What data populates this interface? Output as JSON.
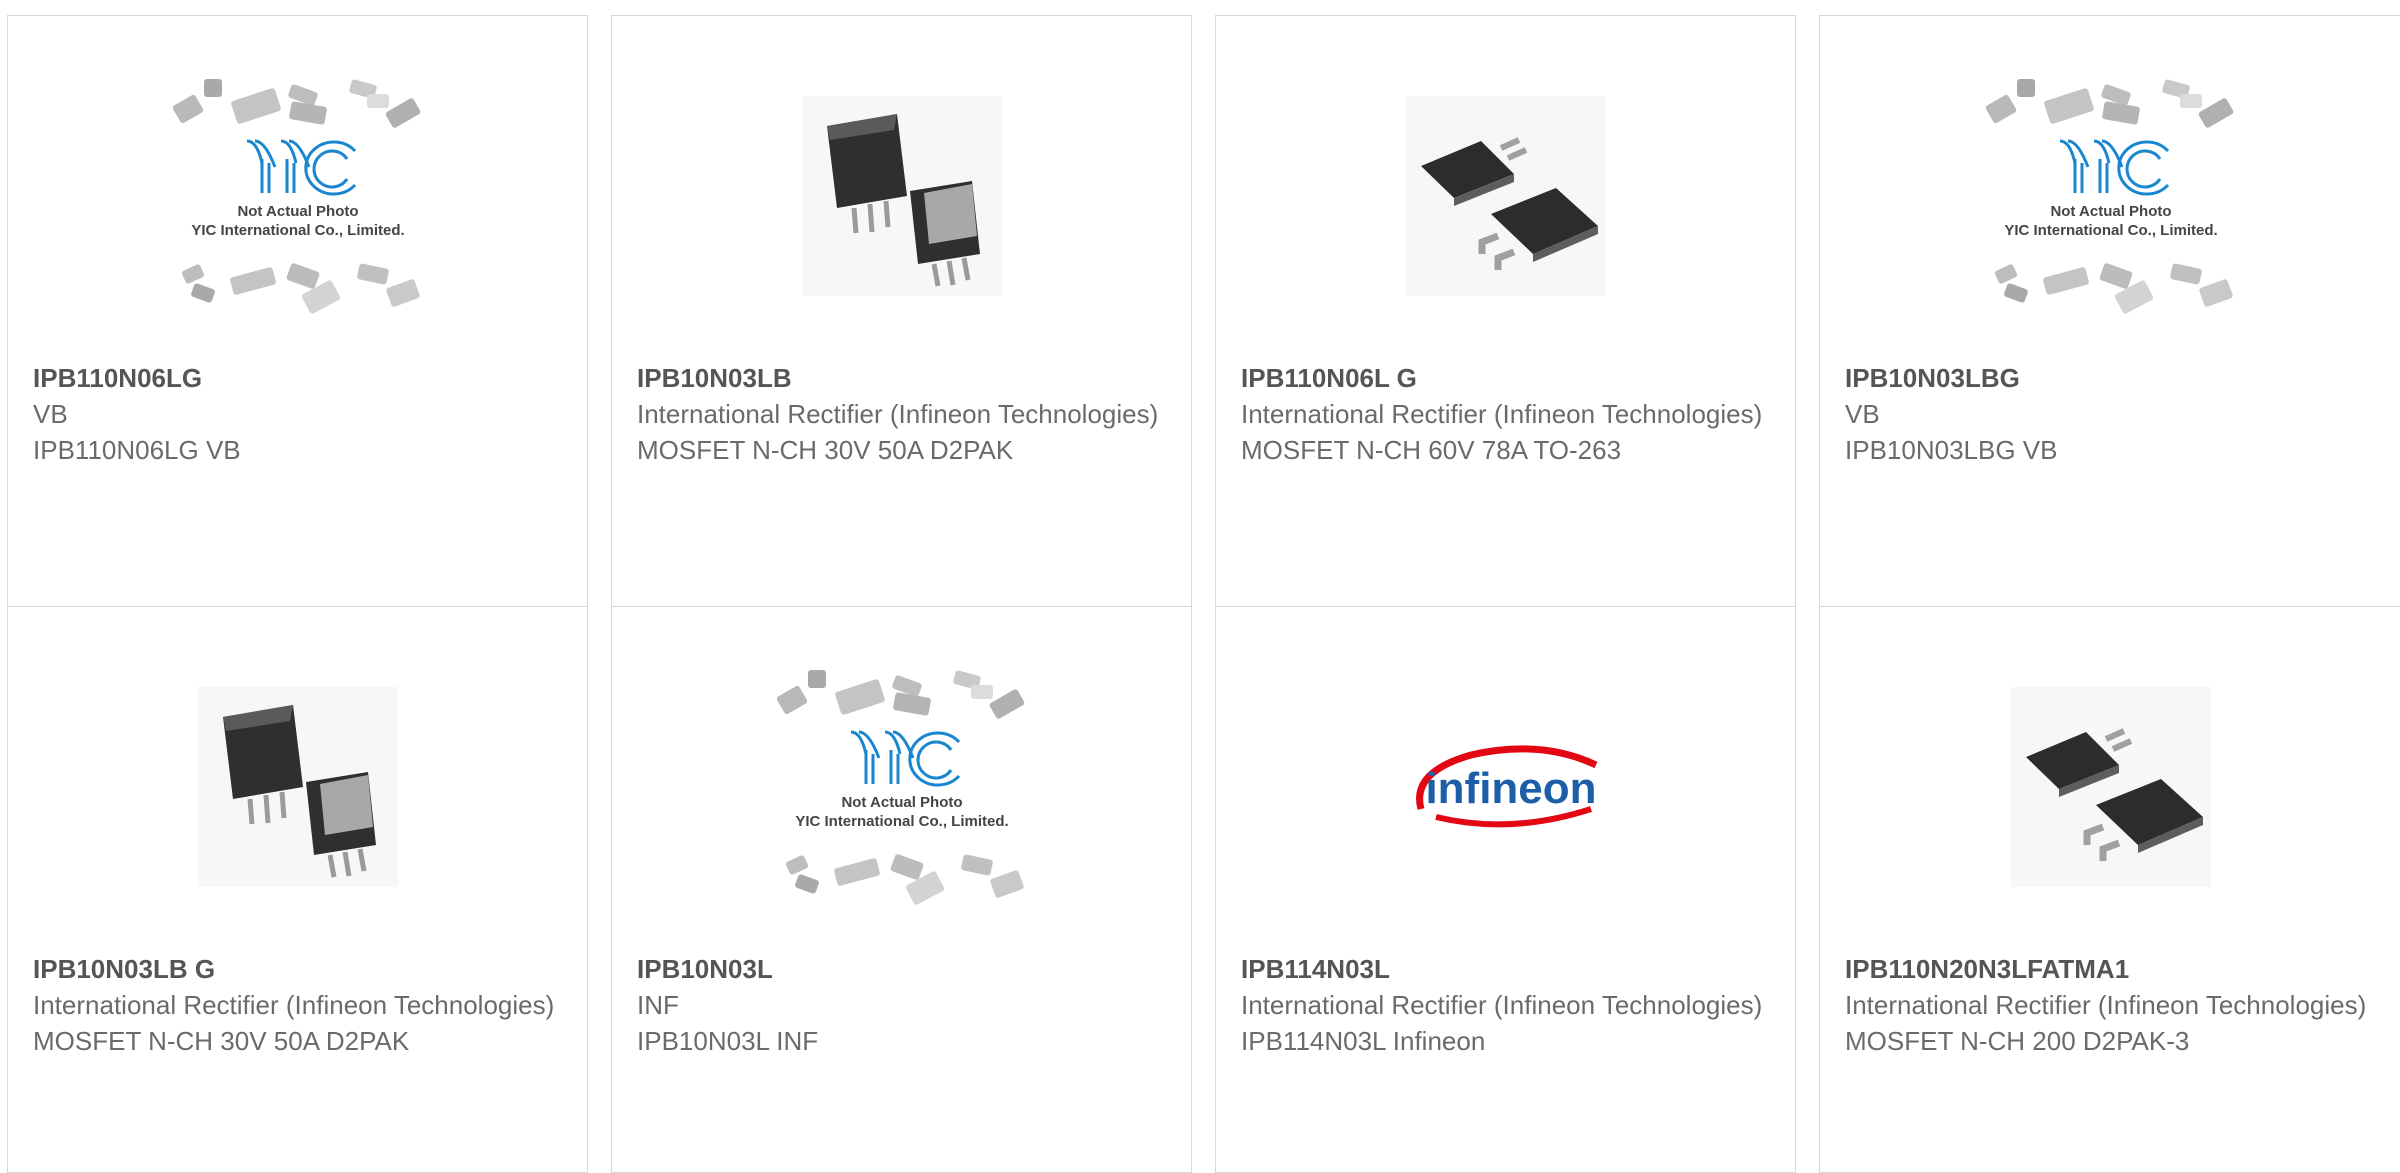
{
  "colors": {
    "accent": "#e8391b",
    "bar": "#3d3d3d",
    "part_number": "#555555",
    "text": "#6a6a6a",
    "yic_blue": "#1a86d0",
    "infineon_red": "#e30613",
    "infineon_blue": "#1c5ea7"
  },
  "placeholder": {
    "line1": "Not Actual Photo",
    "line2": "YIC International Co., Limited.",
    "logo": "YIC"
  },
  "infineon_logo": "infineon",
  "products": [
    {
      "part_number": "IPB110N06LG",
      "manufacturer": "VB",
      "description": "IPB110N06LG VB",
      "image": "placeholder-icon"
    },
    {
      "part_number": "IPB10N03LB",
      "manufacturer": "International Rectifier (Infineon Technologies)",
      "description": "MOSFET N-CH 30V 50A D2PAK",
      "image": "d2pak-angled-icon"
    },
    {
      "part_number": "IPB110N06L G",
      "manufacturer": "International Rectifier (Infineon Technologies)",
      "description": "MOSFET N-CH 60V 78A TO-263",
      "image": "d2pak-flat-icon"
    },
    {
      "part_number": "IPB10N03LBG",
      "manufacturer": "VB",
      "description": "IPB10N03LBG VB",
      "image": "placeholder-icon"
    },
    {
      "part_number": "IPB10N03LB G",
      "manufacturer": "International Rectifier (Infineon Technologies)",
      "description": "MOSFET N-CH 30V 50A D2PAK",
      "image": "d2pak-angled-icon"
    },
    {
      "part_number": "IPB10N03L",
      "manufacturer": "INF",
      "description": "IPB10N03L INF",
      "image": "placeholder-icon"
    },
    {
      "part_number": "IPB114N03L",
      "manufacturer": "International Rectifier (Infineon Technologies)",
      "description": "IPB114N03L Infineon",
      "image": "infineon-logo-icon"
    },
    {
      "part_number": "IPB110N20N3LFATMA1",
      "manufacturer": "International Rectifier (Infineon Technologies)",
      "description": "MOSFET N-CH 200 D2PAK-3",
      "image": "d2pak-flat-icon"
    }
  ]
}
